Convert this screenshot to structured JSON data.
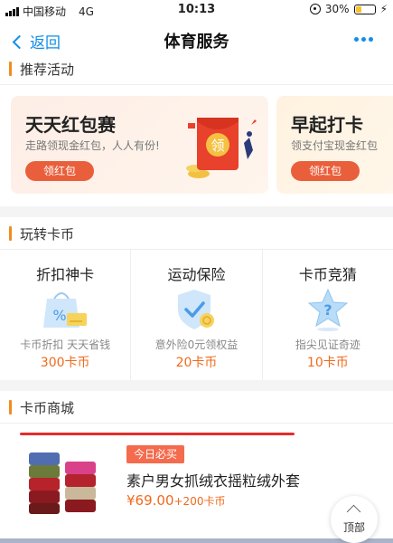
{
  "status_bar": {
    "carrier": "中国移动",
    "network": "4G",
    "time": "10:13",
    "battery": "30%"
  },
  "nav": {
    "back_label": "返回",
    "title": "体育服务"
  },
  "sections": {
    "recommend": "推荐活动",
    "coins": "玩转卡币",
    "mall": "卡币商城"
  },
  "promos": [
    {
      "title": "天天红包赛",
      "subtitle": "走路领现金红包，人人有份!",
      "button": "领红包",
      "envelope_text": "领"
    },
    {
      "title": "早起打卡",
      "subtitle": "领支付宝现金红包",
      "button": "领红包"
    }
  ],
  "coin_items": [
    {
      "title": "折扣神卡",
      "desc": "卡币折扣  天天省钱",
      "price": "300卡币",
      "icon": "discount-card-icon"
    },
    {
      "title": "运动保险",
      "desc": "意外险0元领权益",
      "price": "20卡币",
      "icon": "insurance-shield-icon"
    },
    {
      "title": "卡币竞猜",
      "desc": "指尖见证奇迹",
      "price": "10卡币",
      "icon": "question-star-icon"
    }
  ],
  "product": {
    "badge": "今日必买",
    "name": "素户男女抓绒衣摇粒绒外套",
    "price": "¥69.00",
    "points": "+200卡币"
  },
  "top_button": "顶部",
  "colors": {
    "accent": "#108ee9",
    "section_bar": "#f08c1e",
    "price": "#f06a1c",
    "button": "#ea5f3b"
  }
}
